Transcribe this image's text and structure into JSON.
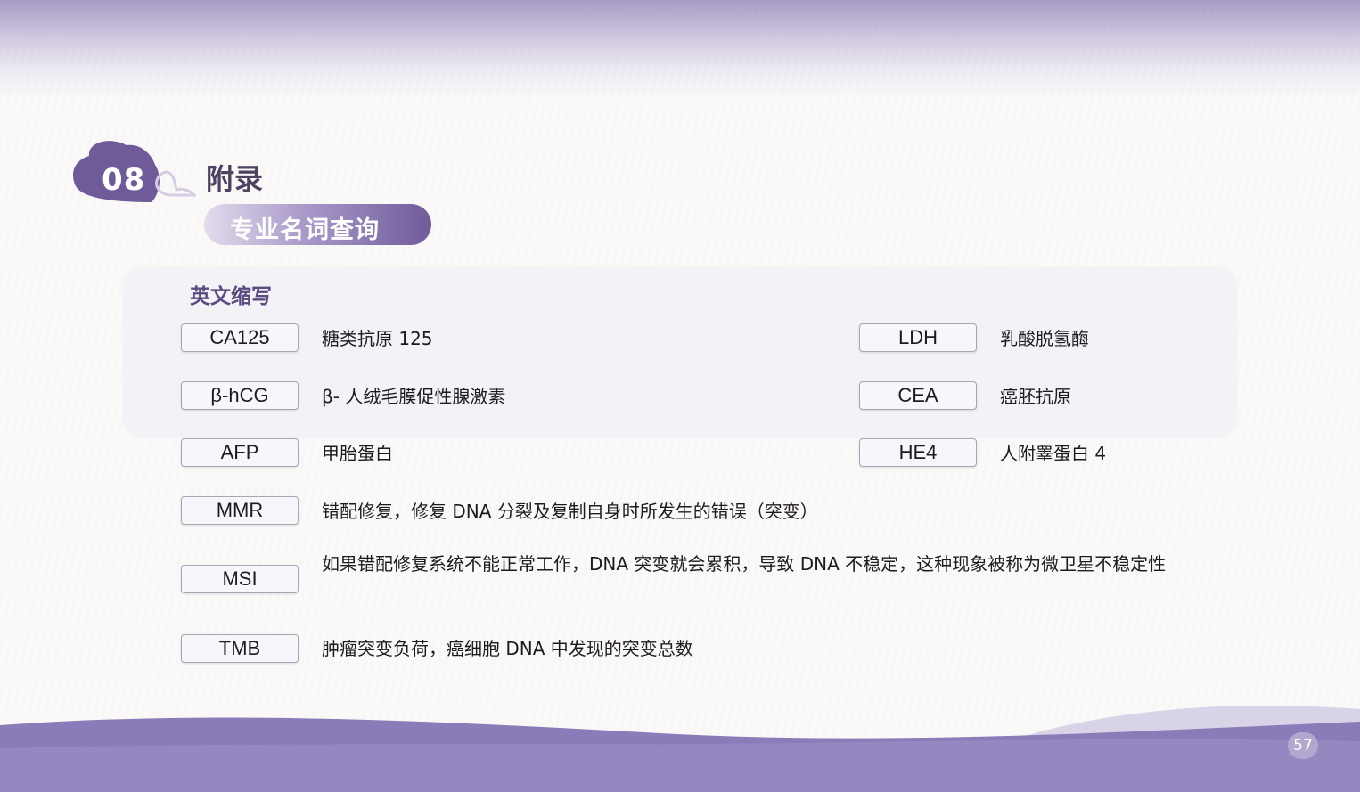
{
  "chapter": {
    "number": "08",
    "title": "附录"
  },
  "section_pill": "专业名词查询",
  "section_heading": "英文缩写",
  "terms": [
    {
      "abbr": "CA125",
      "desc": "糖类抗原 125"
    },
    {
      "abbr": "LDH",
      "desc": "乳酸脱氢酶"
    },
    {
      "abbr": "β-hCG",
      "desc": "β- 人绒毛膜促性腺激素"
    },
    {
      "abbr": "CEA",
      "desc": "癌胚抗原"
    },
    {
      "abbr": "AFP",
      "desc": "甲胎蛋白"
    },
    {
      "abbr": "HE4",
      "desc": "人附睾蛋白 4"
    },
    {
      "abbr": "MMR",
      "desc": "错配修复，修复 DNA 分裂及复制自身时所发生的错误（突变）"
    },
    {
      "abbr": "MSI",
      "desc": "如果错配修复系统不能正常工作，DNA 突变就会累积，导致 DNA 不稳定，这种现象被称为微卫星不稳定性"
    },
    {
      "abbr": "TMB",
      "desc": "肿瘤突变负荷，癌细胞 DNA 中发现的突变总数"
    }
  ],
  "page_number": "57",
  "colors": {
    "accent": "#6f5b9a",
    "accent_light": "#b3a7cf",
    "heading": "#5a4a80"
  }
}
